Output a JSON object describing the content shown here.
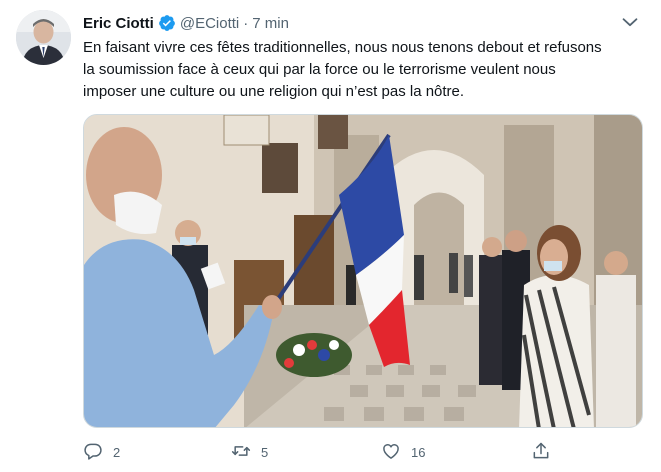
{
  "tweet": {
    "author_name": "Eric Ciotti",
    "handle": "@ECiotti",
    "separator": "·",
    "time": "7 min",
    "text_lines": [
      "En faisant vivre ces fêtes traditionnelles, nous nous tenons debout et refusons",
      "la soumission face à ceux qui par la force ou le terrorisme veulent nous",
      "imposer une culture ou une religion qui n’est pas la nôtre."
    ]
  },
  "actions": {
    "replies": "2",
    "retweets": "5",
    "likes": "16"
  },
  "icons": {
    "verified": "verified-badge-icon",
    "menu": "chevron-down-icon",
    "reply": "reply-icon",
    "retweet": "retweet-icon",
    "like": "heart-icon",
    "share": "share-icon"
  },
  "colors": {
    "accent": "#1d9bf0",
    "muted": "#536471",
    "text": "#0f1419"
  }
}
